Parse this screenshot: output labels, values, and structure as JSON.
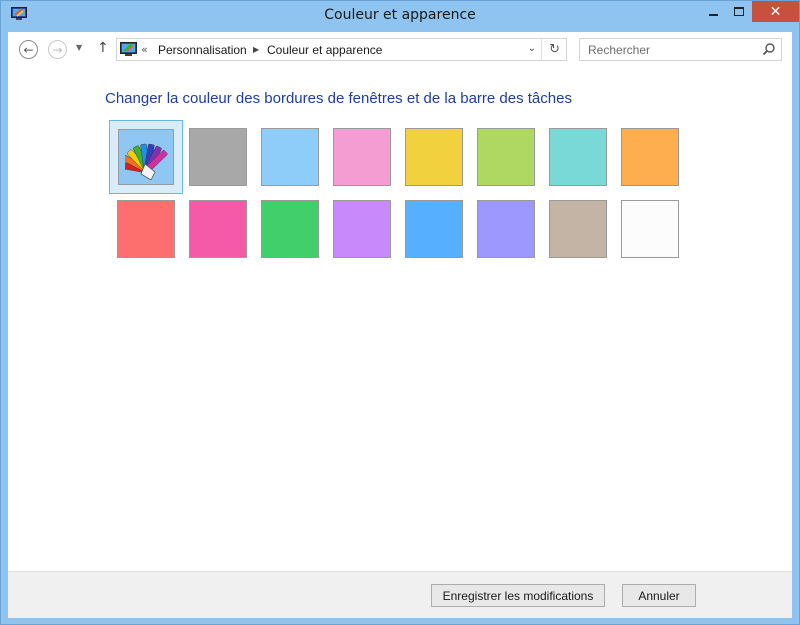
{
  "window": {
    "title": "Couleur et apparence",
    "close_glyph": "✕"
  },
  "nav": {
    "back_glyph": "←",
    "forward_glyph": "→",
    "recent_glyph": "▼",
    "up_glyph": "↑"
  },
  "address": {
    "overflow_glyph": "«",
    "crumbs": [
      "Personnalisation",
      "Couleur et apparence"
    ],
    "separator_glyph": "▶",
    "dropdown_glyph": "⌄",
    "refresh_glyph": "↻"
  },
  "search": {
    "placeholder": "Rechercher"
  },
  "main": {
    "heading": "Changer la couleur des bordures de fenêtres et de la barre des tâches"
  },
  "swatches": {
    "row1": [
      "auto",
      "#a8a8a8",
      "#8ecdfa",
      "#f49dd2",
      "#f1d13e",
      "#aed861",
      "#79d9d6",
      "#ffae4f"
    ],
    "row2": [
      "#fd6e6e",
      "#f45aa8",
      "#41cf6c",
      "#c889fb",
      "#56afff",
      "#9c98fd",
      "#c4b4a6",
      "#fcfcfc"
    ],
    "selected": "auto",
    "selected_icon": "color-palette-icon"
  },
  "footer": {
    "save_label": "Enregistrer les modifications",
    "cancel_label": "Annuler"
  },
  "colors": {
    "titlebar": "#8ec4ef",
    "close_button": "#c7503f",
    "heading": "#1e3f9a",
    "selection_border": "#6fb5e2"
  }
}
